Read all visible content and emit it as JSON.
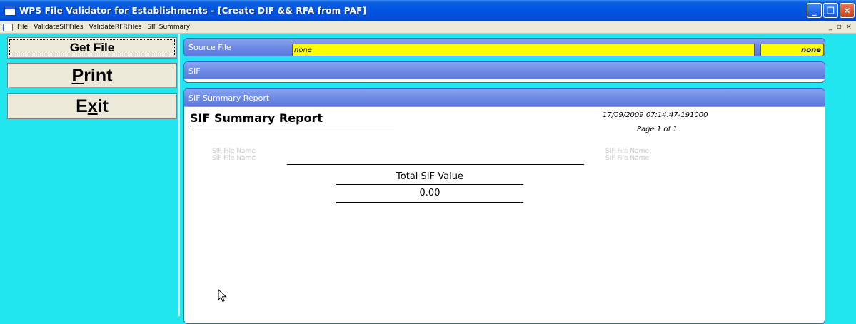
{
  "window": {
    "title": "WPS File Validator for Establishments - [Create DIF && RFA from PAF]",
    "minimize_icon": "minimize-icon",
    "restore_icon": "restore-icon",
    "close_icon": "close-icon"
  },
  "menubar": {
    "items": [
      "File",
      "ValidateSIFFiles",
      "ValidateRFRFiles",
      "SIF Summary"
    ],
    "mdi_controls": [
      "_",
      "▫",
      "×"
    ]
  },
  "sidebar": {
    "get_file": "Get File",
    "print_underlined": "P",
    "print_rest": "rint",
    "exit_first": "E",
    "exit_underlined": "x",
    "exit_rest": "it"
  },
  "source": {
    "header": "Source File",
    "value": "none",
    "badge": "none"
  },
  "sif": {
    "header": "SIF"
  },
  "summary": {
    "header": "SIF Summary Report",
    "report_title": "SIF Summary Report",
    "datetime": "17/09/2009 07:14:47-191000",
    "page": "Page 1 of 1",
    "left_label_1": "SIF File Name",
    "left_label_2": "SIF File Name",
    "right_label_1": "SIF File Name",
    "right_label_2": "SIF File Name",
    "total_label": "Total SIF Value",
    "total_value": "0.00"
  },
  "colors": {
    "background": "#22e6ee",
    "titlebar": "#0054e3",
    "group_header": "#6f8ae4",
    "highlight": "#ffff00"
  }
}
